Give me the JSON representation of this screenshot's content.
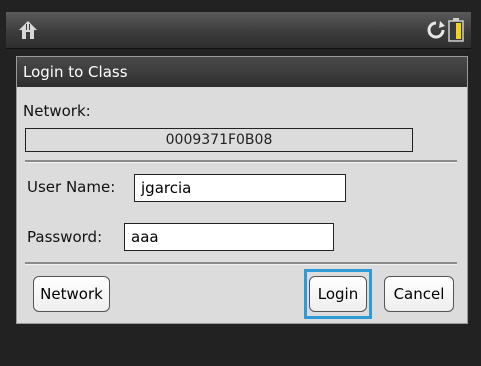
{
  "status_bar": {
    "home_icon": "home-icon",
    "sync_icon": "sync-icon",
    "battery_icon": "battery-icon"
  },
  "dialog": {
    "title": "Login to Class",
    "network_label": "Network:",
    "network_value": "0009371F0B08",
    "username_label": "User Name:",
    "username_value": "jgarcia",
    "password_label": "Password:",
    "password_value": "aaa",
    "buttons": {
      "network": "Network",
      "login": "Login",
      "cancel": "Cancel"
    }
  },
  "colors": {
    "dialog_bg": "#dcdcdc",
    "title_bg": "#2f2f2f",
    "focus": "#2e9bd6"
  }
}
